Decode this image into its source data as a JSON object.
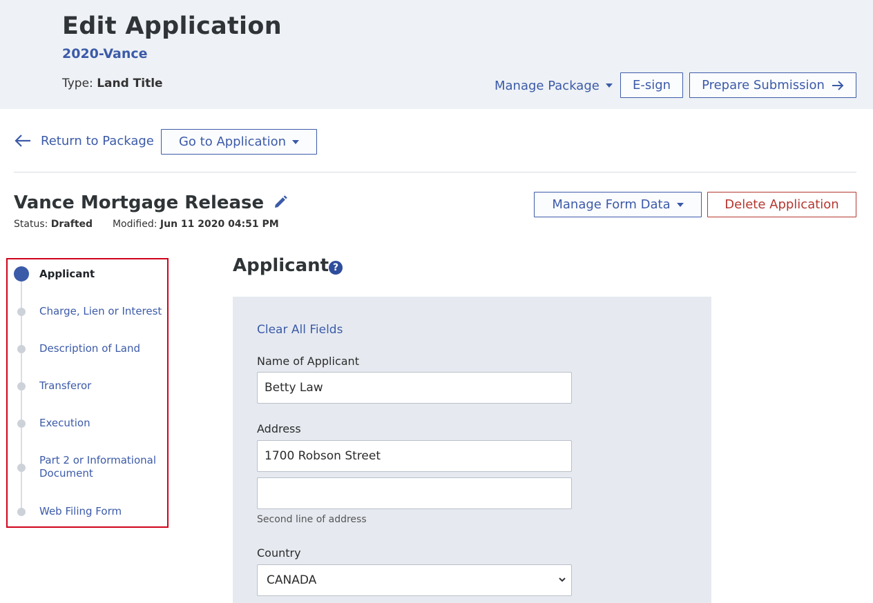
{
  "header": {
    "title": "Edit Application",
    "file_reference": "2020-Vance",
    "type_label": "Type:",
    "type_value": "Land Title",
    "manage_package_label": "Manage Package",
    "esign_label": "E-sign",
    "prepare_submission_label": "Prepare Submission"
  },
  "nav": {
    "return_label": "Return to Package",
    "go_to_application_label": "Go to Application"
  },
  "application": {
    "name": "Vance Mortgage Release",
    "status_label": "Status:",
    "status_value": "Drafted",
    "modified_label": "Modified:",
    "modified_value": "Jun 11 2020 04:51 PM",
    "manage_form_data_label": "Manage Form Data",
    "delete_label": "Delete Application"
  },
  "stepper": {
    "steps": [
      {
        "label": "Applicant",
        "active": true
      },
      {
        "label": "Charge, Lien or Interest",
        "active": false
      },
      {
        "label": "Description of Land",
        "active": false
      },
      {
        "label": "Transferor",
        "active": false
      },
      {
        "label": "Execution",
        "active": false
      },
      {
        "label": "Part 2 or Informational Document",
        "active": false
      },
      {
        "label": "Web Filing Form",
        "active": false
      }
    ]
  },
  "form": {
    "section_title": "Applicant",
    "clear_all_label": "Clear All Fields",
    "name_label": "Name of Applicant",
    "name_value": "Betty Law",
    "address_label": "Address",
    "address_line1_value": "1700 Robson Street",
    "address_line2_value": "",
    "address_line2_hint": "Second line of address",
    "country_label": "Country",
    "country_value": "CANADA"
  },
  "colors": {
    "accent": "#3b5aa8",
    "danger": "#b5362e",
    "header_bg": "#eef1f5",
    "panel_bg": "#e6eaf0",
    "highlight_border": "#d0021b"
  }
}
